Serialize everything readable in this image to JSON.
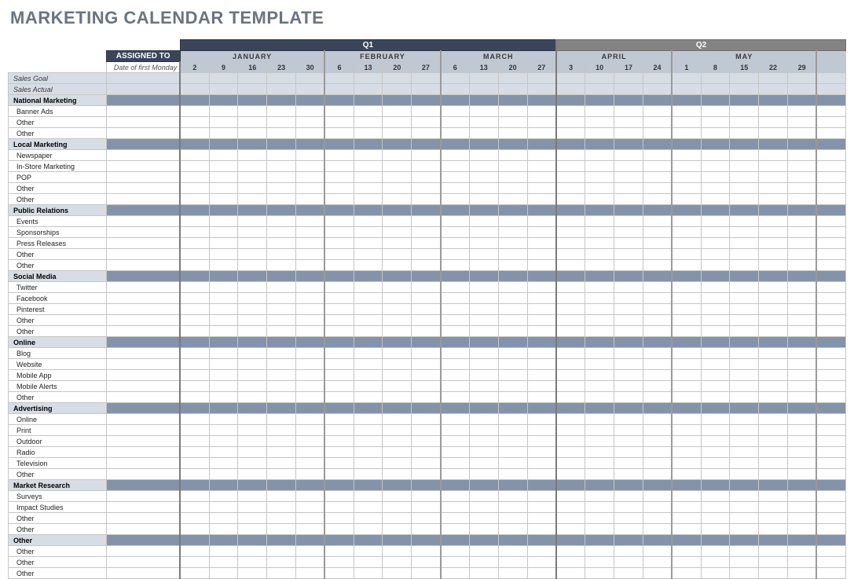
{
  "title": "MARKETING CALENDAR TEMPLATE",
  "header": {
    "assigned_to": "ASSIGNED TO",
    "date_of_first_monday": "Date of first Monday",
    "quarters": [
      {
        "label": "Q1",
        "cls": "qtr-q1",
        "months": [
          {
            "label": "JANUARY",
            "weeks": [
              "2",
              "9",
              "16",
              "23",
              "30"
            ]
          },
          {
            "label": "FEBRUARY",
            "weeks": [
              "6",
              "13",
              "20",
              "27"
            ]
          },
          {
            "label": "MARCH",
            "weeks": [
              "6",
              "13",
              "20",
              "27"
            ]
          }
        ]
      },
      {
        "label": "Q2",
        "cls": "qtr-q2",
        "months": [
          {
            "label": "APRIL",
            "weeks": [
              "3",
              "10",
              "17",
              "24"
            ]
          },
          {
            "label": "MAY",
            "weeks": [
              "1",
              "8",
              "15",
              "22",
              "29"
            ]
          },
          {
            "label": "",
            "weeks": [
              ""
            ]
          }
        ]
      }
    ]
  },
  "sales_rows": [
    {
      "label": "Sales Goal"
    },
    {
      "label": "Sales Actual"
    }
  ],
  "categories": [
    {
      "label": "National Marketing",
      "items": [
        "Banner Ads",
        "Other",
        "Other"
      ]
    },
    {
      "label": "Local Marketing",
      "items": [
        "Newspaper",
        "In-Store Marketing",
        "POP",
        "Other",
        "Other"
      ]
    },
    {
      "label": "Public Relations",
      "items": [
        "Events",
        "Sponsorships",
        "Press Releases",
        "Other",
        "Other"
      ]
    },
    {
      "label": "Social Media",
      "items": [
        "Twitter",
        "Facebook",
        "Pinterest",
        "Other",
        "Other"
      ]
    },
    {
      "label": "Online",
      "items": [
        "Blog",
        "Website",
        "Mobile App",
        "Mobile Alerts",
        "Other"
      ]
    },
    {
      "label": "Advertising",
      "items": [
        "Online",
        "Print",
        "Outdoor",
        "Radio",
        "Television",
        "Other"
      ]
    },
    {
      "label": "Market Research",
      "items": [
        "Surveys",
        "Impact Studies",
        "Other",
        "Other"
      ]
    },
    {
      "label": "Other",
      "items": [
        "Other",
        "Other",
        "Other"
      ]
    }
  ]
}
